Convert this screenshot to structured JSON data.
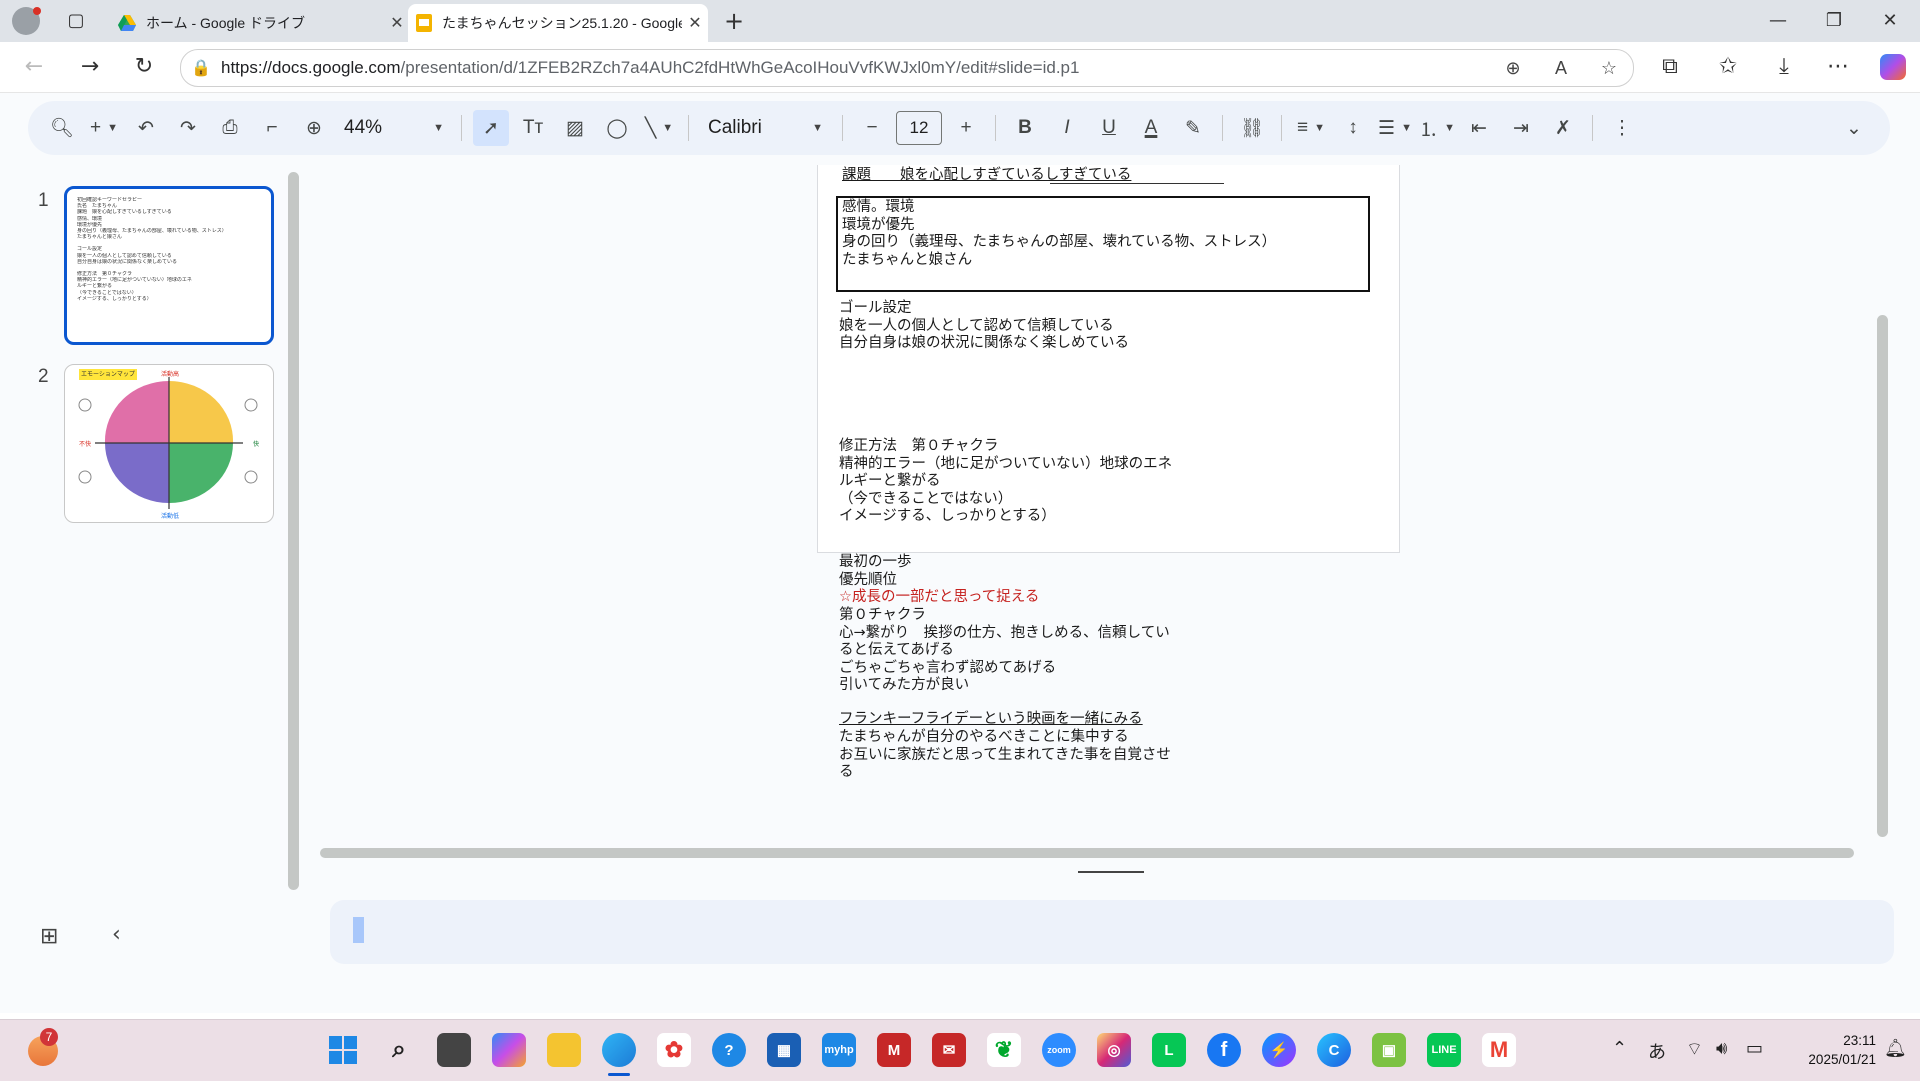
{
  "browser": {
    "tabs": [
      {
        "title": "ホーム - Google ドライブ",
        "active": false
      },
      {
        "title": "たまちゃんセッション25.1.20 - Google",
        "active": true
      }
    ],
    "new_tab": "+",
    "url_host": "https://docs.google.com",
    "url_path": "/presentation/d/1ZFEB2RZch7a4AUhC2fdHtWhGeAcoIHouVvfKWJxl0mY/edit#slide=id.p1"
  },
  "toolbar": {
    "zoom": "44%",
    "font": "Calibri",
    "font_size": "12",
    "minus": "−",
    "plus": "+"
  },
  "filmstrip": {
    "slides": [
      {
        "number": "1",
        "selected": true
      },
      {
        "number": "2",
        "selected": false
      }
    ],
    "thumb1_lines": [
      "初回確認キーワードセラピー",
      "氏名　たまちゃん",
      "課題　娘を心配しすぎているしすぎている",
      "感情、環境",
      "環境が優先",
      "身の回り（義理母、たまちゃんの部屋、壊れている物、ストレス）",
      "たまちゃんと娘さん",
      "ゴール設定",
      "娘を一人の個人として認めて信頼している",
      "自分自身は娘の状況に関係なく楽しめている",
      "修正方法　第０チャクラ",
      "精神的エラー（地に足がついていない）地球のエネ",
      "ルギーと繋がる",
      "（今できることではない）",
      "イメージする、しっかりとする）"
    ],
    "thumb2_title": "エモーションマップ",
    "thumb2_top": "活動高",
    "thumb2_bottom": "活動低",
    "thumb2_left": "不快",
    "thumb2_right": "快"
  },
  "slide": {
    "issue": "課題　　娘を心配しすぎているしすぎている",
    "box_lines": [
      "感情。環境",
      "環境が優先",
      "身の回り（義理母、たまちゃんの部屋、壊れている物、ストレス）",
      "たまちゃんと娘さん"
    ],
    "goal_lines": [
      "ゴール設定",
      "娘を一人の個人として認めて信頼している",
      "自分自身は娘の状況に関係なく楽しめている"
    ],
    "method_lines": [
      "修正方法　第０チャクラ",
      "精神的エラー（地に足がついていない）地球のエネ",
      "ルギーと繋がる",
      "（今できることではない）",
      "イメージする、しっかりとする）"
    ],
    "first_step": [
      "最初の一歩",
      "優先順位"
    ],
    "red_line": "☆成長の一部だと思って捉える",
    "chakra_lines": [
      "第０チャクラ",
      "心→繋がり　挨拶の仕方、抱きしめる、信頼してい",
      "ると伝えてあげる",
      "ごちゃごちゃ言わず認めてあげる",
      "引いてみた方が良い"
    ],
    "movie_line": "フランキーフライデーという映画を一緒にみる",
    "last_lines": [
      "たまちゃんが自分のやるべきことに集中する",
      "お互いに家族だと思って生まれてきた事を自覚させ",
      "る"
    ]
  },
  "taskbar": {
    "badge": "7",
    "ime": "あ",
    "time": "23:11",
    "date": "2025/01/21"
  },
  "colors": {
    "accent": "#0b57d0",
    "red_text": "#c5221f",
    "toolbar_bg": "#edf2fa"
  }
}
